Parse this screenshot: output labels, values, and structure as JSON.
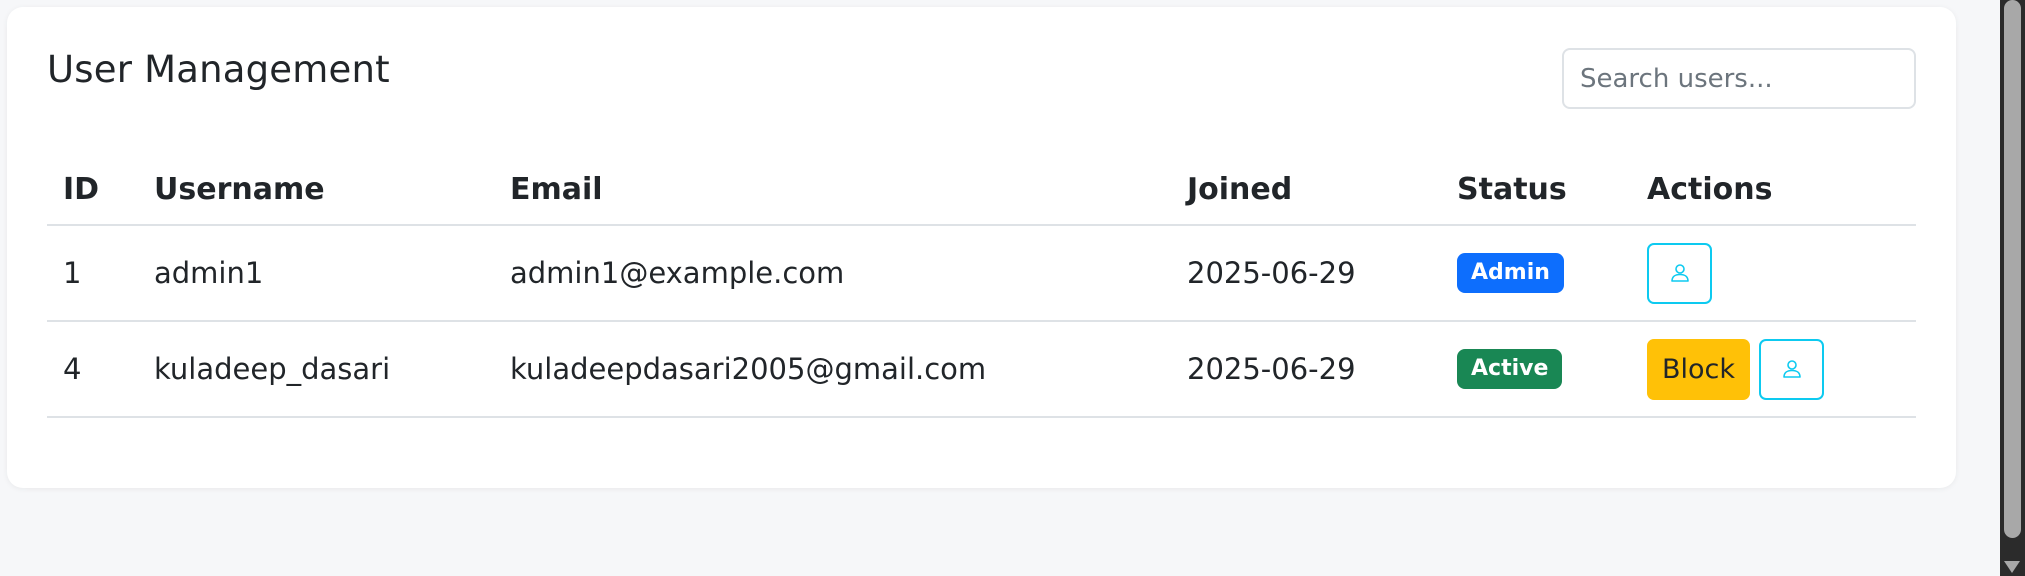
{
  "page": {
    "title": "User Management",
    "search_placeholder": "Search users..."
  },
  "table": {
    "columns": [
      "ID",
      "Username",
      "Email",
      "Joined",
      "Status",
      "Actions"
    ],
    "rows": [
      {
        "id": "1",
        "username": "admin1",
        "email": "admin1@example.com",
        "joined": "2025-06-29",
        "status": "Admin",
        "actions": []
      },
      {
        "id": "4",
        "username": "kuladeep_dasari",
        "email": "kuladeepdasari2005@gmail.com",
        "joined": "2025-06-29",
        "status": "Active",
        "actions": [
          "Block"
        ]
      }
    ]
  },
  "icons": {
    "view_profile": "person-icon"
  },
  "colors": {
    "admin_badge": "#0d6efd",
    "active_badge": "#198754",
    "block_button": "#ffc107",
    "icon_button_border": "#0dcaf0"
  }
}
